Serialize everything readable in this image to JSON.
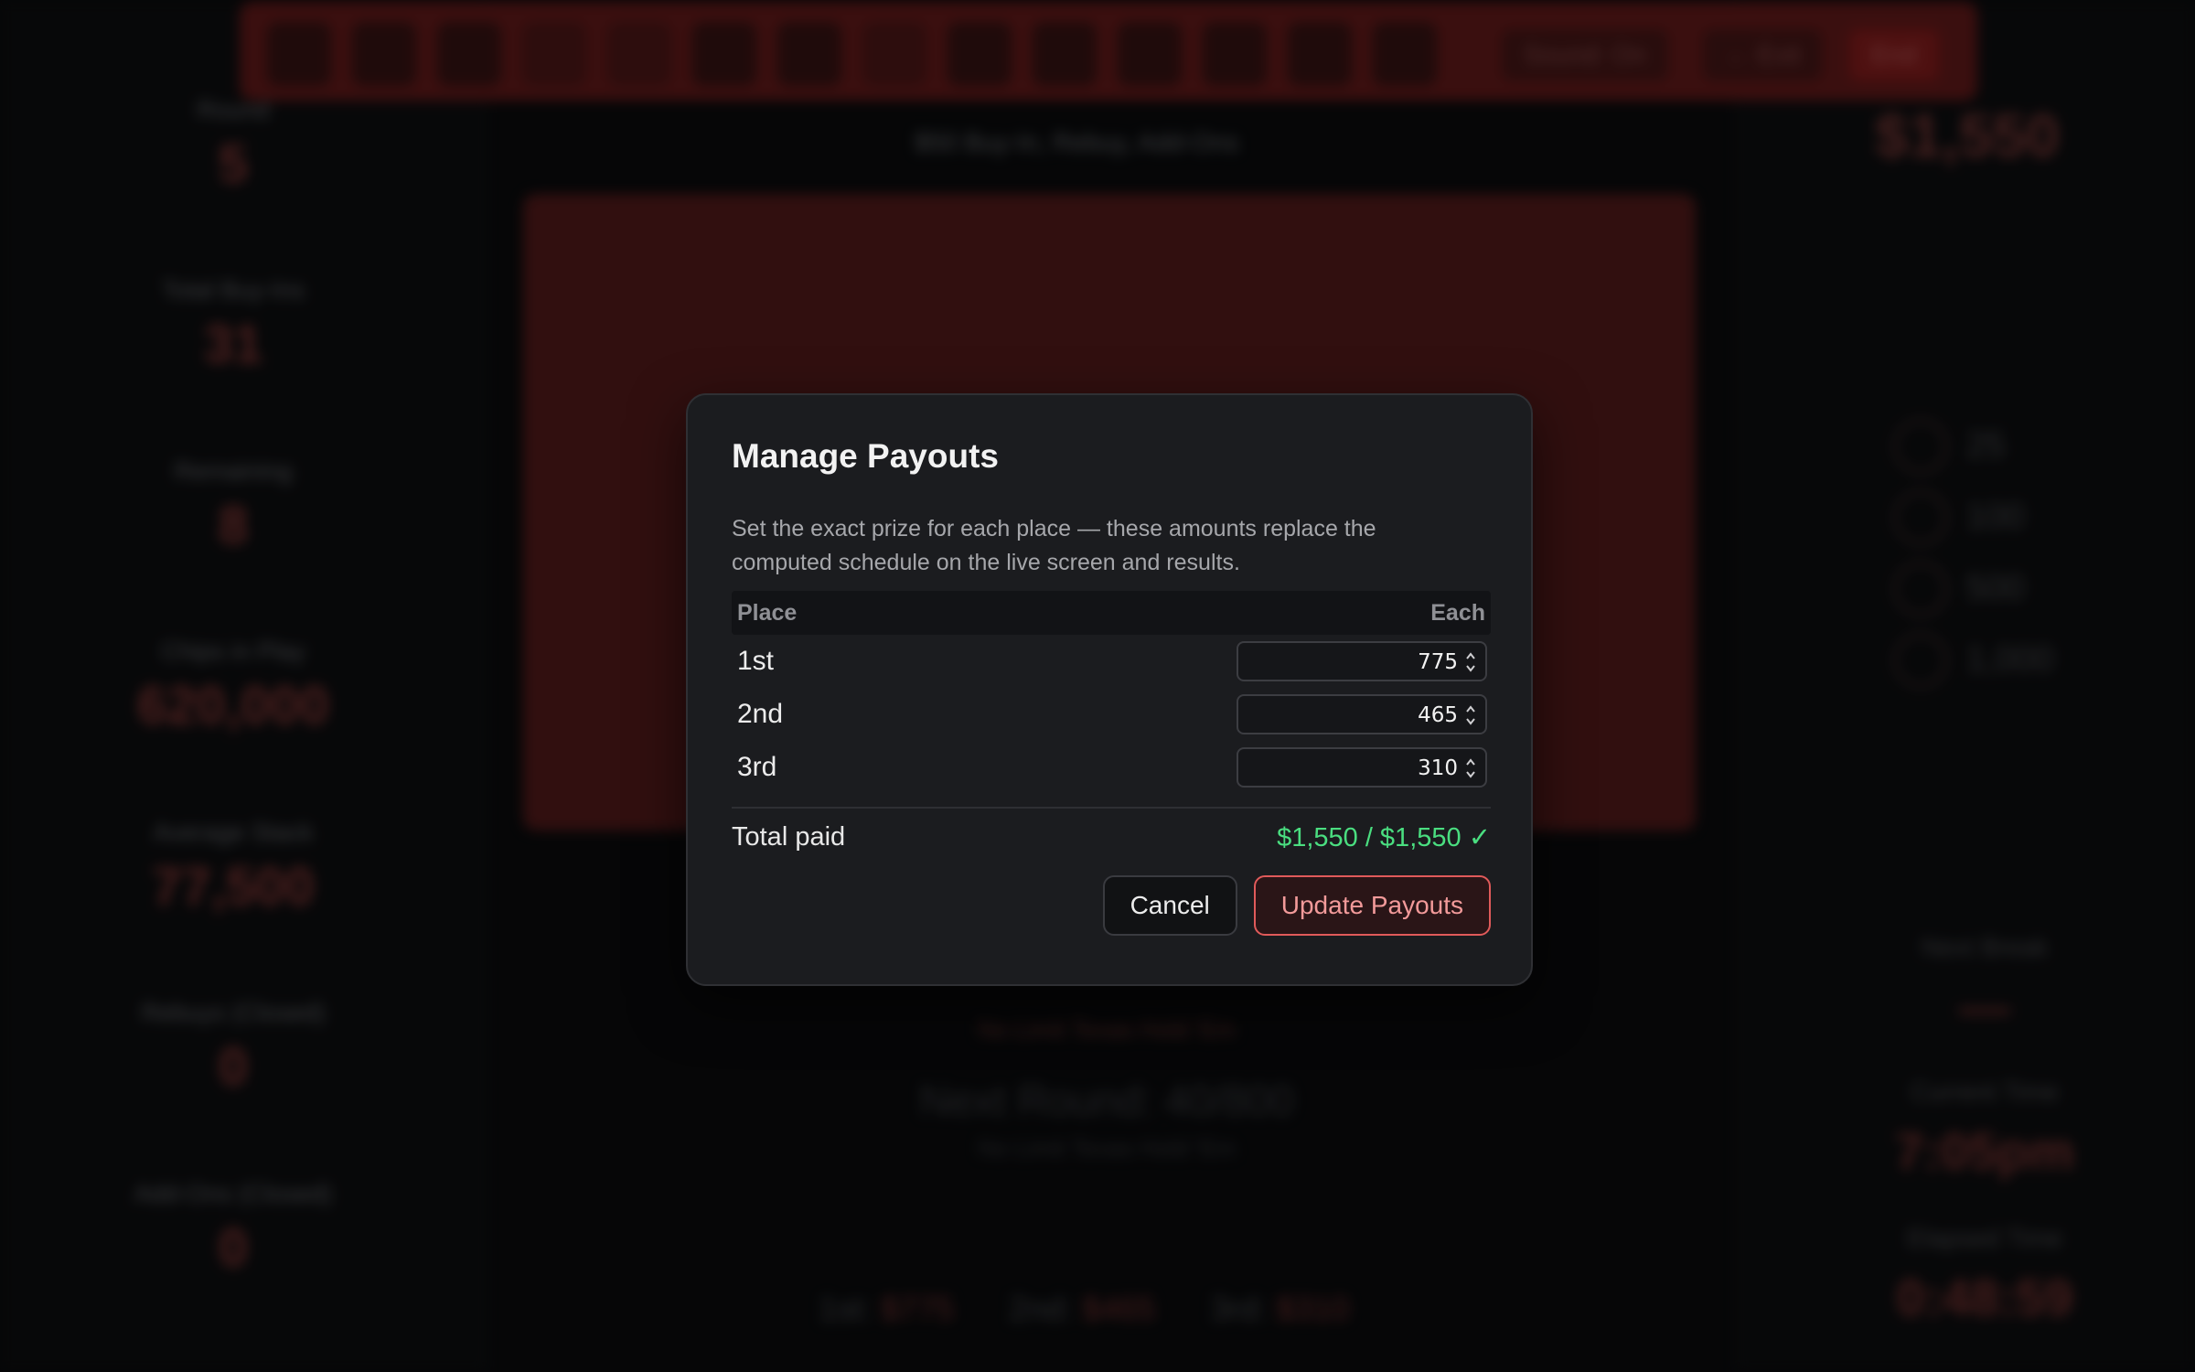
{
  "background": {
    "toolbar": {
      "sound_label": "Sound: On",
      "exit_label": "← Exit",
      "end_label": "End"
    },
    "level_title": "$50 Buy-In, Rebuy, Add-Ons",
    "stats": [
      {
        "label": "Round",
        "value": "5"
      },
      {
        "label": "Total Buy-Ins",
        "value": "31"
      },
      {
        "label": "Remaining",
        "value": "8"
      },
      {
        "label": "Chips in Play",
        "value": "620,000"
      },
      {
        "label": "Average Stack",
        "value": "77,500"
      },
      {
        "label": "Rebuys (Closed)",
        "value": "0"
      },
      {
        "label": "Add-Ons (Closed)",
        "value": "0"
      }
    ],
    "game_line": "No Limit Texas Hold 'Em",
    "next_round": "Next Round: 40/800",
    "next_game": "No Limit Texas Hold 'Em",
    "payouts": [
      {
        "place": "1st:",
        "amount": "$775"
      },
      {
        "place": "2nd:",
        "amount": "$465"
      },
      {
        "place": "3rd:",
        "amount": "$310"
      }
    ],
    "prize_pool": "$1,550",
    "chips": [
      "25",
      "100",
      "500",
      "1,000"
    ],
    "right_stats": [
      {
        "label": "Next Break",
        "value": "—"
      },
      {
        "label": "Current Time",
        "value": "7:05pm"
      },
      {
        "label": "Elapsed Time",
        "value": "0:48:59"
      }
    ]
  },
  "modal": {
    "title": "Manage Payouts",
    "description": "Set the exact prize for each place — these amounts replace the computed schedule on the live screen and results.",
    "table": {
      "col_place": "Place",
      "col_each": "Each",
      "rows": [
        {
          "place": "1st",
          "amount": "775"
        },
        {
          "place": "2nd",
          "amount": "465"
        },
        {
          "place": "3rd",
          "amount": "310"
        }
      ]
    },
    "total_label": "Total paid",
    "total_value": "$1,550 / $1,550 ✓",
    "cancel_label": "Cancel",
    "update_label": "Update Payouts"
  },
  "colors": {
    "accent": "#e05a5a",
    "success": "#4ade80",
    "modal_bg": "#1b1c1f"
  }
}
